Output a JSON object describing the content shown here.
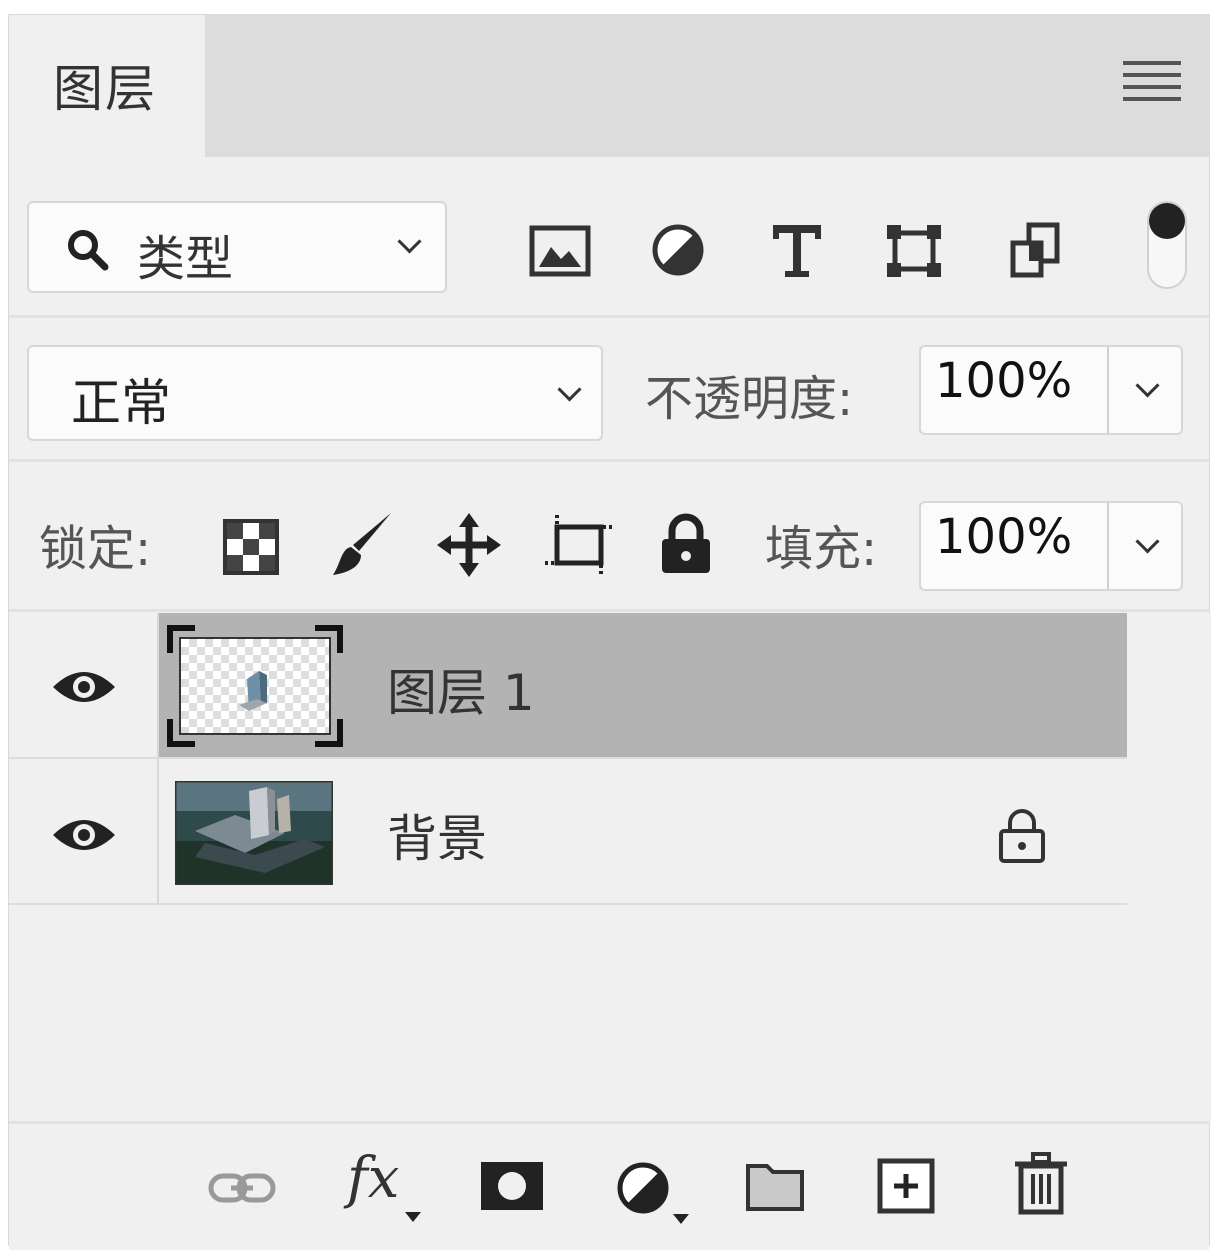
{
  "panel": {
    "tab_title": "图层",
    "menu_icon": "hamburger-menu-icon"
  },
  "filter": {
    "kind_label": "类型",
    "icons": [
      "image-filter-icon",
      "adjustment-filter-icon",
      "text-filter-icon",
      "shape-filter-icon",
      "smart-object-filter-icon"
    ],
    "toggle_state": "on"
  },
  "blend": {
    "mode": "正常",
    "opacity_label": "不透明度:",
    "opacity_value": "100%"
  },
  "lock": {
    "label": "锁定:",
    "icons": [
      "lock-transparent-pixels-icon",
      "lock-image-pixels-icon",
      "lock-position-icon",
      "lock-artboard-icon",
      "lock-all-icon"
    ],
    "fill_label": "填充:",
    "fill_value": "100%"
  },
  "layers": [
    {
      "name": "图层 1",
      "visible": true,
      "selected": true,
      "locked": false
    },
    {
      "name": "背景",
      "visible": true,
      "selected": false,
      "locked": true
    }
  ],
  "footer": {
    "icons": [
      "link-layers-icon",
      "fx-icon",
      "add-mask-icon",
      "adjustment-layer-icon",
      "new-group-icon",
      "new-layer-icon",
      "delete-icon"
    ],
    "fx_text": "fx"
  },
  "colors": {
    "selected_row": "#b3b3b3",
    "panel_bg": "#f0f0f0"
  }
}
